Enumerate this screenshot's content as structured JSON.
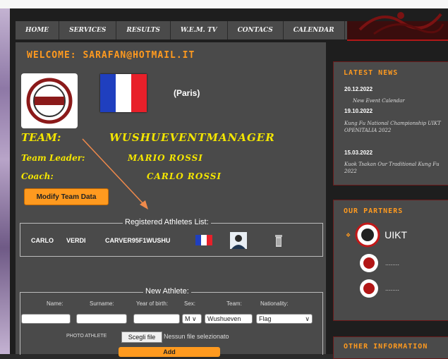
{
  "nav": {
    "items": [
      "HOME",
      "SERVICES",
      "RESULTS",
      "W.E.M. TV",
      "CONTACS",
      "CALENDAR"
    ]
  },
  "welcome": {
    "label": "WELCOME:",
    "email": "SARAFAN@HOTMAIL.IT"
  },
  "team": {
    "city": "(Paris)",
    "team_label": "TEAM:",
    "team_name": "WUSHUEVENTMANAGER",
    "leader_label": "Team Leader:",
    "leader_name": "MARIO ROSSI",
    "coach_label": "Coach:",
    "coach_name": "CARLO ROSSI",
    "modify_button": "Modify Team Data",
    "flag_colors": [
      "#1f3fbf",
      "#ffffff",
      "#e8202a"
    ]
  },
  "athletes": {
    "legend": "Registered Athletes List:",
    "rows": [
      {
        "first": "CARLO",
        "last": "VERDI",
        "code": "CARVER95F1WUSHU"
      }
    ]
  },
  "new_athlete": {
    "legend": "New Athlete:",
    "labels": [
      "Name:",
      "Surname:",
      "Year of birth:",
      "Sex:",
      "Team:",
      "Nationality:"
    ],
    "sex_value": "M",
    "team_value": "Wushueven",
    "nationality_value": "Flag",
    "photo_label": "PHOTO ATHLETE",
    "file_button": "Scegli file",
    "file_status": "Nessun file selezionato",
    "add_button": "Add"
  },
  "sidebar": {
    "news_title": "LATEST NEWS",
    "news": [
      {
        "date": "20.12.2022",
        "text": "New Event Calendar"
      },
      {
        "date": "19.10.2022",
        "text": "Kung Fu National Championship UIKT OPENITALIA 2022"
      },
      {
        "date": "15.03.2022",
        "text": "Kuok Tsakan Our Traditional Kung Fu 2022"
      }
    ],
    "partners_title": "OUR PARTNERS",
    "partners": [
      "UIKT",
      "........",
      "........"
    ],
    "other_title": "OTHER INFORMATION"
  },
  "colors": {
    "accent": "#ff9a1f",
    "team_text": "#f4e600",
    "panel": "#4a4a4a"
  }
}
